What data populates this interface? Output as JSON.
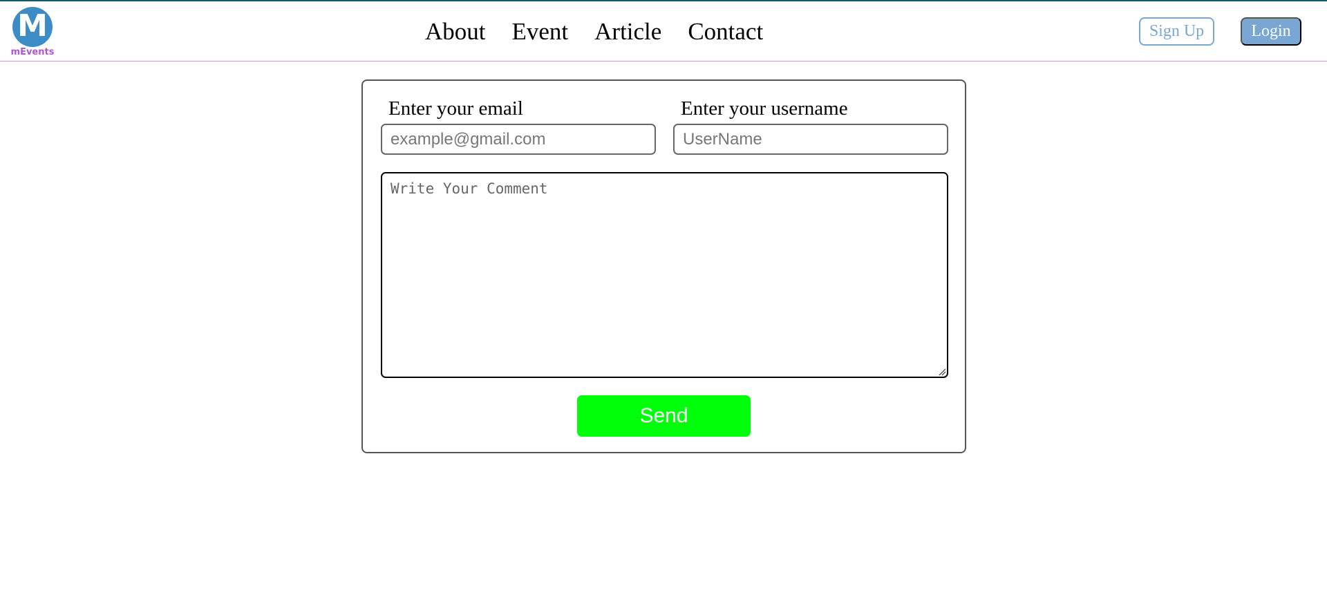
{
  "brand": {
    "logo_letter": "M",
    "name": "mEvents",
    "logo_color": "#3d8cc6",
    "name_color": "#b255d4"
  },
  "nav": {
    "items": [
      {
        "label": "About"
      },
      {
        "label": "Event"
      },
      {
        "label": "Article"
      },
      {
        "label": "Contact"
      }
    ]
  },
  "auth": {
    "signup_label": "Sign Up",
    "login_label": "Login",
    "accent_color": "#7aa6d3"
  },
  "form": {
    "email_label": "Enter your email",
    "email_placeholder": "example@gmail.com",
    "email_value": "",
    "username_label": "Enter your username",
    "username_placeholder": "UserName",
    "username_value": "",
    "comment_placeholder": "Write Your Comment",
    "comment_value": "",
    "send_label": "Send",
    "send_color": "#00ff0a"
  }
}
